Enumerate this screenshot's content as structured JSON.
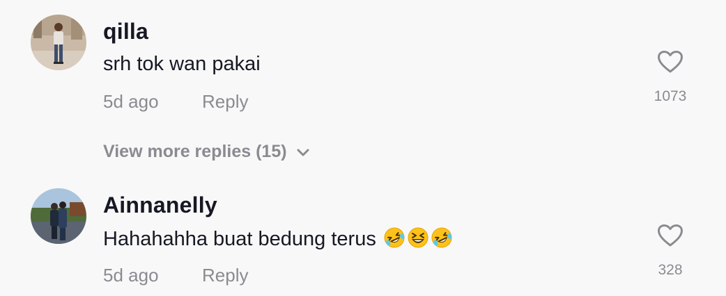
{
  "comments": [
    {
      "username": "qilla",
      "text": "srh tok wan pakai",
      "emojis": [],
      "time": "5d ago",
      "reply_label": "Reply",
      "likes": "1073",
      "avatar_icon": "avatar-photo-standing-person"
    },
    {
      "username": "Ainnanelly",
      "text": "Hahahahha buat bedung terus ",
      "emojis": [
        "rolling-on-floor-laughing",
        "grinning-squinting-face",
        "rolling-on-floor-laughing"
      ],
      "time": "5d ago",
      "reply_label": "Reply",
      "likes": "328",
      "avatar_icon": "avatar-photo-outdoor-couple"
    }
  ],
  "view_more_replies": "View more replies (15)",
  "icons": {
    "like": "heart-outline-icon",
    "expand": "chevron-down-icon"
  },
  "colors": {
    "background": "#f8f8f8",
    "primary_text": "#161823",
    "secondary_text": "#8a8b91"
  }
}
